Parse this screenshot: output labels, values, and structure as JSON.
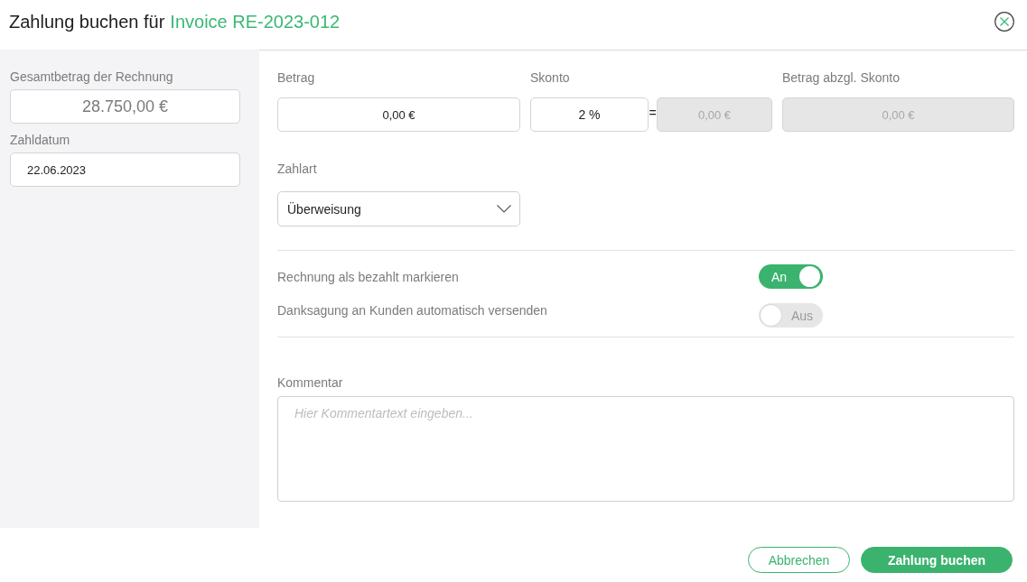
{
  "dialog": {
    "title": "Zahlung buchen für",
    "invoice_number": "Invoice RE-2023-012"
  },
  "summary": {
    "total": {
      "label": "Gesamtbetrag der Rechnung",
      "value": "28.750,00 €"
    },
    "payment_date": {
      "label": "Zahldatum",
      "value": "22.06.2023"
    }
  },
  "amount": {
    "label": "Betrag",
    "value": "0,00 €"
  },
  "discount": {
    "label": "Skonto",
    "percent": "2 %",
    "equals": "=",
    "amount": "0,00 €",
    "amount_disabled": true
  },
  "net_amount": {
    "label": "Betrag abzgl. Skonto",
    "value": "0,00 €",
    "disabled": true
  },
  "payment_method": {
    "label": "Zahlart",
    "value": "Überweisung"
  },
  "toggles": [
    {
      "label": "Rechnung als bezahlt markieren",
      "on": true,
      "state_label": "An"
    },
    {
      "label": "Danksagung an Kunden automatisch versenden",
      "on": false,
      "state_label": "Aus"
    }
  ],
  "comment": {
    "label": "Kommentar",
    "placeholder": "Hier Kommentartext eingeben..."
  },
  "buttons": [
    {
      "label": "Abbrechen",
      "kind": "secondary"
    },
    {
      "label": "Zahlung buchen",
      "kind": "primary"
    }
  ]
}
